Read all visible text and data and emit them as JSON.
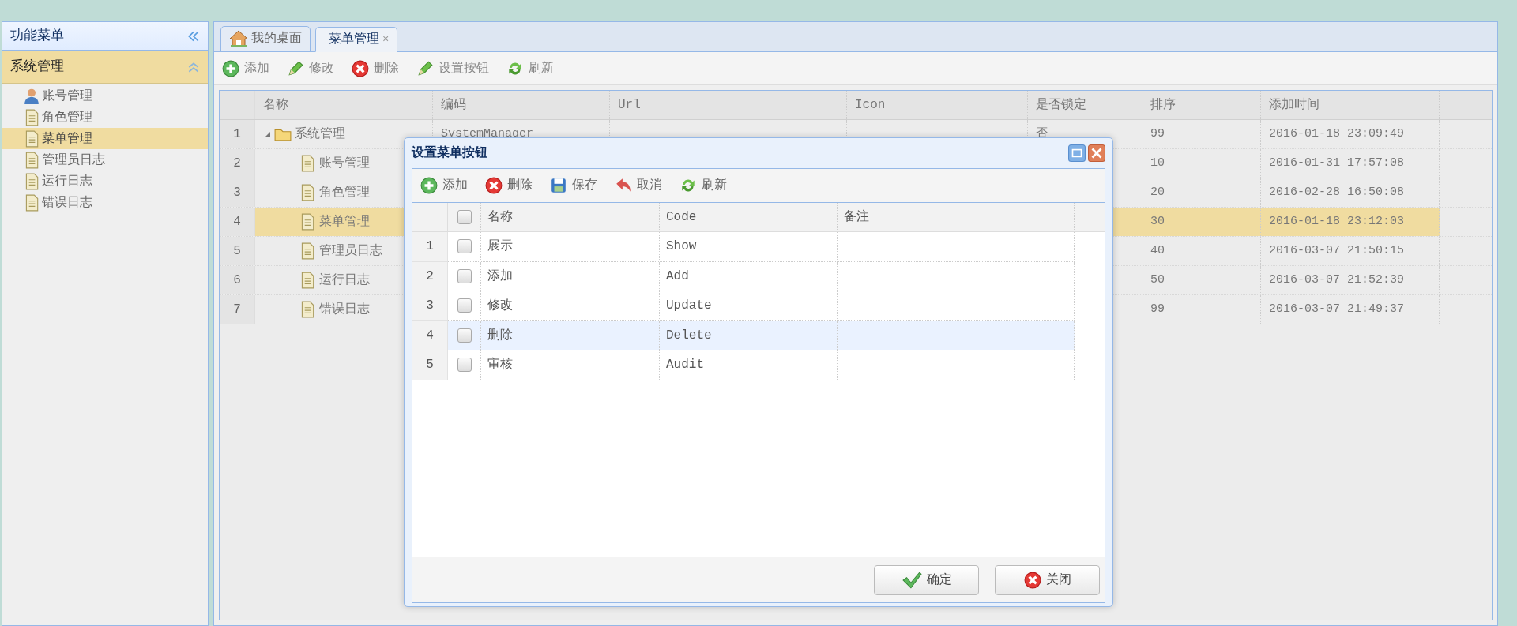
{
  "left_panel": {
    "title": "功能菜单",
    "section": {
      "title": "系统管理",
      "expanded": true,
      "items": [
        {
          "label": "账号管理",
          "kind": "user",
          "selected": false
        },
        {
          "label": "角色管理",
          "kind": "page",
          "selected": false
        },
        {
          "label": "菜单管理",
          "kind": "page",
          "selected": true
        },
        {
          "label": "管理员日志",
          "kind": "page",
          "selected": false
        },
        {
          "label": "运行日志",
          "kind": "page",
          "selected": false
        },
        {
          "label": "错误日志",
          "kind": "page",
          "selected": false
        }
      ]
    }
  },
  "tabs": [
    {
      "label": "我的桌面",
      "kind": "home",
      "selected": false
    },
    {
      "label": "菜单管理",
      "kind": "plain",
      "selected": true,
      "close": "×"
    }
  ],
  "toolbar": [
    {
      "label": "添加",
      "kind": "add"
    },
    {
      "label": "修改",
      "kind": "edit"
    },
    {
      "label": "删除",
      "kind": "delete"
    },
    {
      "label": "设置按钮",
      "kind": "edit"
    },
    {
      "label": "刷新",
      "kind": "refresh"
    }
  ],
  "grid": {
    "columns": [
      "名称",
      "编码",
      "Url",
      "Icon",
      "是否锁定",
      "排序",
      "添加时间"
    ],
    "rows": [
      {
        "index": "1",
        "name": "系统管理",
        "kind": "folder",
        "expanded": true,
        "code": "SystemManager",
        "locked": "否",
        "sort": "99",
        "added": "2016-01-18 23:09:49",
        "selected": false,
        "children": [
          {
            "index": "2",
            "name": "账号管理",
            "kind": "page",
            "sort": "10",
            "added": "2016-01-31 17:57:08",
            "selected": false
          },
          {
            "index": "3",
            "name": "角色管理",
            "kind": "page",
            "sort": "20",
            "added": "2016-02-28 16:50:08",
            "selected": false
          },
          {
            "index": "4",
            "name": "菜单管理",
            "kind": "page",
            "sort": "30",
            "added": "2016-01-18 23:12:03",
            "selected": true
          },
          {
            "index": "5",
            "name": "管理员日志",
            "kind": "page",
            "sort": "40",
            "added": "2016-03-07 21:50:15",
            "selected": false
          },
          {
            "index": "6",
            "name": "运行日志",
            "kind": "page",
            "sort": "50",
            "added": "2016-03-07 21:52:39",
            "selected": false
          },
          {
            "index": "7",
            "name": "错误日志",
            "kind": "page",
            "sort": "99",
            "added": "2016-03-07 21:49:37",
            "selected": false
          }
        ]
      }
    ]
  },
  "dialog": {
    "title": "设置菜单按钮",
    "toolbar": [
      {
        "label": "添加",
        "kind": "add"
      },
      {
        "label": "删除",
        "kind": "delete"
      },
      {
        "label": "保存",
        "kind": "save"
      },
      {
        "label": "取消",
        "kind": "cancel"
      },
      {
        "label": "刷新",
        "kind": "refresh"
      }
    ],
    "grid": {
      "select_all": {
        "checked": false
      },
      "columns": [
        "名称",
        "Code",
        "备注"
      ],
      "rows": [
        {
          "index": "1",
          "name": "展示",
          "code": "Show",
          "checked": false,
          "selected": false
        },
        {
          "index": "2",
          "name": "添加",
          "code": "Add",
          "checked": false,
          "selected": false
        },
        {
          "index": "3",
          "name": "修改",
          "code": "Update",
          "checked": false,
          "selected": false
        },
        {
          "index": "4",
          "name": "删除",
          "code": "Delete",
          "checked": false,
          "selected": true
        },
        {
          "index": "5",
          "name": "审核",
          "code": "Audit",
          "checked": false,
          "selected": false
        }
      ]
    },
    "buttons": [
      {
        "label": "确定",
        "kind": "ok"
      },
      {
        "label": "关闭",
        "kind": "delete"
      }
    ]
  }
}
